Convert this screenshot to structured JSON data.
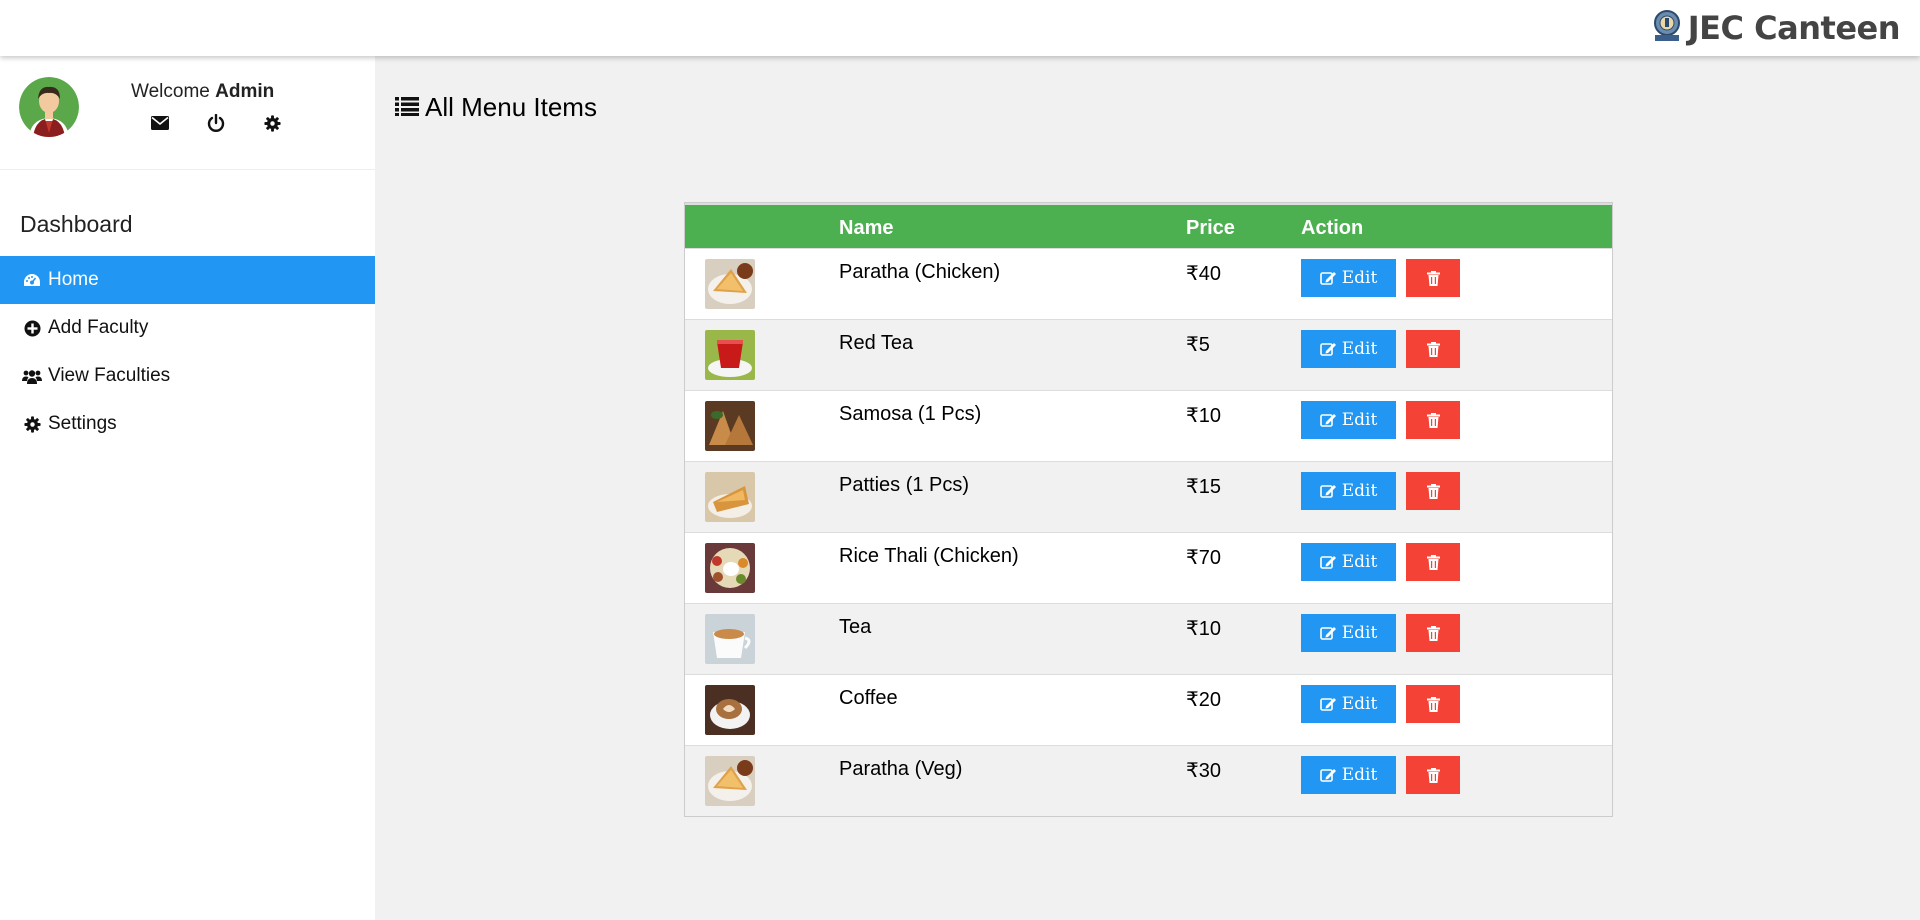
{
  "header": {
    "brand": "JEC Canteen",
    "logo_icon": "emblem-icon"
  },
  "profile": {
    "welcome": "Welcome",
    "user": "Admin",
    "icons": [
      "envelope-icon",
      "power-icon",
      "gear-icon"
    ]
  },
  "sidebar": {
    "title": "Dashboard",
    "items": [
      {
        "label": "Home",
        "icon": "dashboard-icon",
        "active": true
      },
      {
        "label": "Add Faculty",
        "icon": "plus-circle-icon",
        "active": false
      },
      {
        "label": "View Faculties",
        "icon": "users-icon",
        "active": false
      },
      {
        "label": "Settings",
        "icon": "gear-icon",
        "active": false
      }
    ]
  },
  "main": {
    "title": "All Menu Items",
    "title_icon": "list-icon",
    "table": {
      "headers": [
        "",
        "Name",
        "Price",
        "Action"
      ],
      "edit_label": "Edit",
      "rows": [
        {
          "name": "Paratha (Chicken)",
          "price": "₹40"
        },
        {
          "name": "Red Tea",
          "price": "₹5"
        },
        {
          "name": "Samosa (1 Pcs)",
          "price": "₹10"
        },
        {
          "name": "Patties (1 Pcs)",
          "price": "₹15"
        },
        {
          "name": "Rice Thali (Chicken)",
          "price": "₹70"
        },
        {
          "name": "Tea",
          "price": "₹10"
        },
        {
          "name": "Coffee",
          "price": "₹20"
        },
        {
          "name": "Paratha (Veg)",
          "price": "₹30"
        }
      ]
    }
  },
  "colors": {
    "header_green": "#4CAF50",
    "active_blue": "#2196F3",
    "edit_blue": "#2196F3",
    "delete_red": "#f44336"
  }
}
